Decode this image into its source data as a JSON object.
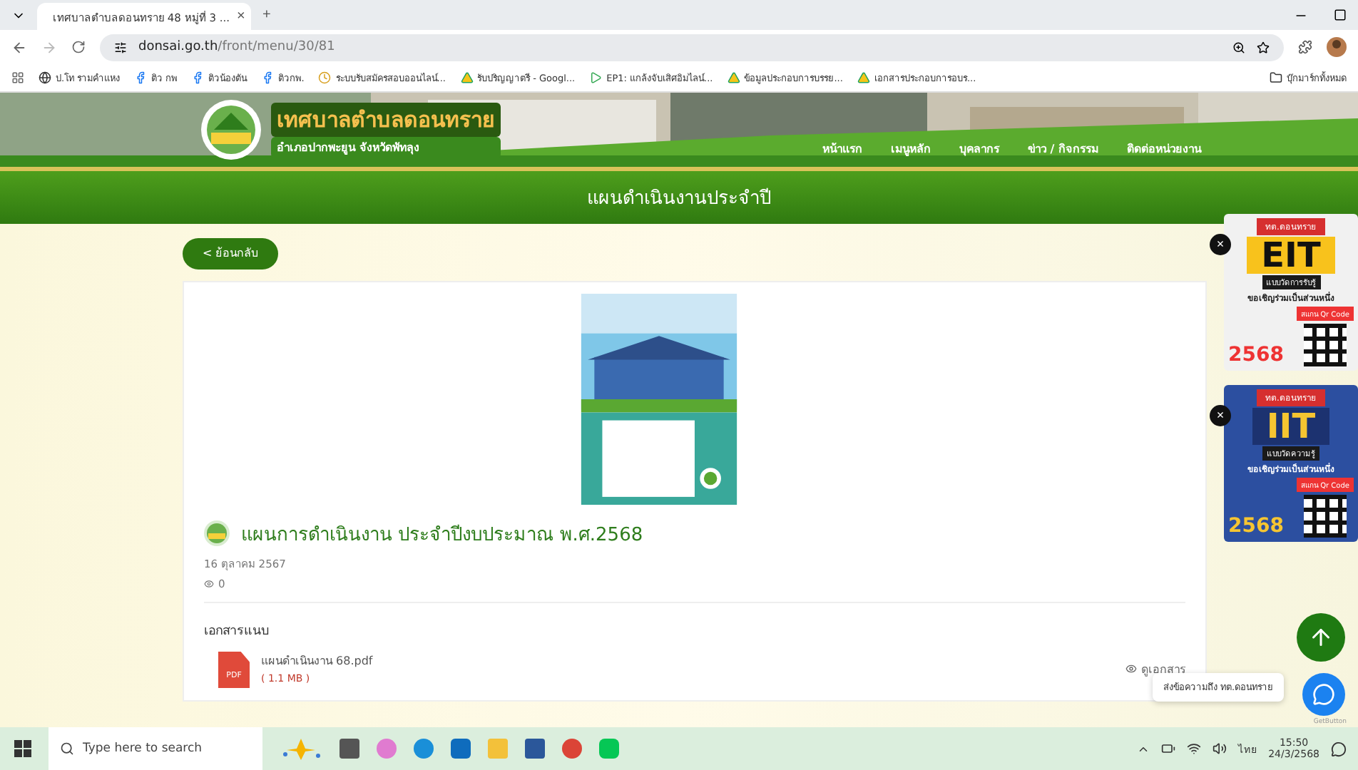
{
  "browser": {
    "tab": {
      "title": "เทศบาลตำบลดอนทราย 48 หมู่ที่ 3 ...",
      "close": "×"
    },
    "new_tab": "+",
    "url": {
      "host": "donsai.go.th",
      "path": "/front/menu/30/81"
    },
    "bookmarks": [
      {
        "kind": "globe",
        "label": "ป.โท รามคำแหง"
      },
      {
        "kind": "facebook",
        "label": "ติว กพ"
      },
      {
        "kind": "facebook",
        "label": "ติวน้องตัน"
      },
      {
        "kind": "facebook",
        "label": "ติวกพ."
      },
      {
        "kind": "clock",
        "label": "ระบบรับสมัครสอบออนไลน์..."
      },
      {
        "kind": "drive",
        "label": "รับปริญญาตรี - Googl..."
      },
      {
        "kind": "play",
        "label": "EP1: แกล้งจับเสิศอิมไลน์..."
      },
      {
        "kind": "drive",
        "label": "ข้อมูลประกอบการบรรย..."
      },
      {
        "kind": "drive",
        "label": "เอกสารประกอบการอบร..."
      }
    ],
    "all_bookmarks": "บุ๊กมาร์กทั้งหมด"
  },
  "header": {
    "site_name": "เทศบาลตำบลดอนทราย",
    "site_sub": "อำเภอปากพะยูน จังหวัดพัทลุง",
    "nav": [
      "หน้าแรก",
      "เมนูหลัก",
      "บุคลากร",
      "ข่าว / กิจกรรม",
      "ติดต่อหน่วยงาน"
    ],
    "page_title": "แผนดำเนินงานประจำปี"
  },
  "back_button": "< ย้อนกลับ",
  "post": {
    "title": "แผนการดำเนินงาน ประจำปีงบประมาณ พ.ศ.2568",
    "date": "16 ตุลาคม 2567",
    "views": "0",
    "attachments_heading": "เอกสารแนบ",
    "file": {
      "badge": "PDF",
      "name": "แผนดำเนินงาน 68.pdf",
      "size": "( 1.1 MB )",
      "view_link": "ดูเอกสาร"
    }
  },
  "ads": [
    {
      "kind": "eit",
      "close": "×",
      "tag": "ทต.ดอนทราย",
      "title": "EIT",
      "subtitle": "แบบวัดการรับรู้",
      "invite": "ขอเชิญร่วมเป็นส่วนหนึ่ง",
      "scan": "สแกน Qr Code",
      "year": "2568"
    },
    {
      "kind": "iit",
      "close": "×",
      "tag": "ทต.ดอนทราย",
      "title": "IIT",
      "subtitle": "แบบวัดความรู้",
      "invite": "ขอเชิญร่วมเป็นส่วนหนึ่ง",
      "scan": "สแกน Qr Code",
      "year": "2568"
    }
  ],
  "chat": {
    "tooltip": "ส่งข้อความถึง ทต.ดอนทราย",
    "brand": "GetButton"
  },
  "taskbar": {
    "search_placeholder": "Type here to search",
    "language": "ไทย",
    "time": "15:50",
    "date": "24/3/2568"
  }
}
